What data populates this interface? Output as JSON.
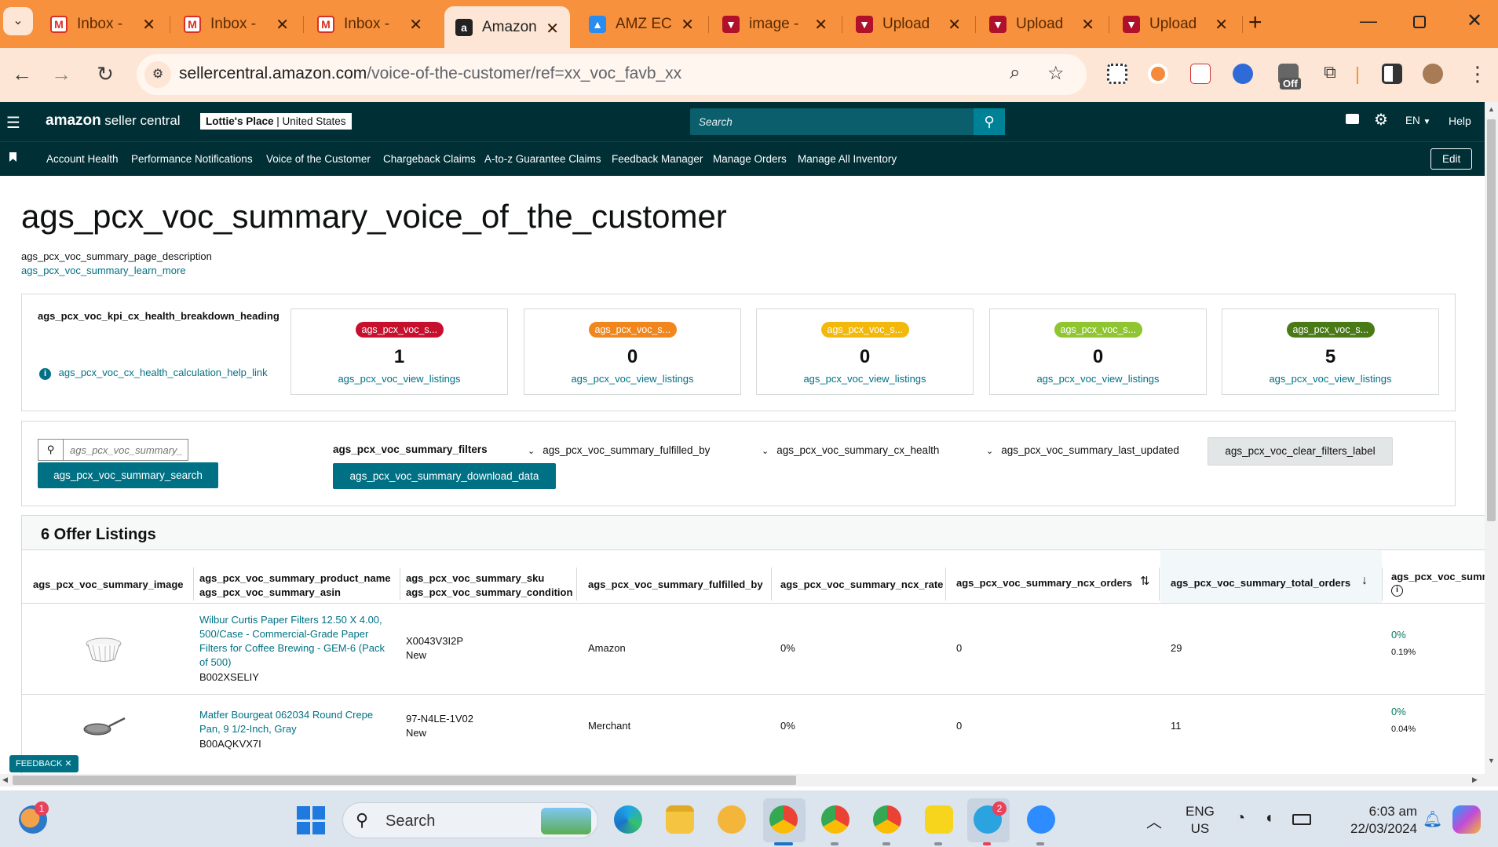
{
  "browser": {
    "tabs": [
      {
        "label": "Inbox -",
        "icon": "gmail-icon"
      },
      {
        "label": "Inbox -",
        "icon": "gmail-icon"
      },
      {
        "label": "Inbox -",
        "icon": "gmail-icon"
      },
      {
        "label": "Amazon",
        "icon": "amazon-icon",
        "active": true
      },
      {
        "label": "AMZ EC",
        "icon": "app-icon"
      },
      {
        "label": "image -",
        "icon": "upload-app-icon"
      },
      {
        "label": "Upload",
        "icon": "upload-app-icon"
      },
      {
        "label": "Upload",
        "icon": "upload-app-icon"
      },
      {
        "label": "Upload",
        "icon": "upload-app-icon"
      }
    ],
    "new_tab": "+",
    "url_host": "sellercentral.amazon.com",
    "url_path": "/voice-of-the-customer/ref=xx_voc_favb_xx",
    "ext_badge": "Off"
  },
  "header": {
    "logo_amazon": "amazon",
    "logo_seller": "seller central",
    "store": "Lottie's Place",
    "marketplace": "United States",
    "search_placeholder": "Search",
    "language": "EN",
    "help": "Help"
  },
  "nav": {
    "items": [
      "Account Health",
      "Performance Notifications",
      "Voice of the Customer",
      "Chargeback Claims",
      "A-to-z Guarantee Claims",
      "Feedback Manager",
      "Manage Orders",
      "Manage All Inventory"
    ],
    "edit": "Edit"
  },
  "page": {
    "title": "ags_pcx_voc_summary_voice_of_the_customer",
    "description": "ags_pcx_voc_summary_page_description",
    "learn_more": "ags_pcx_voc_summary_learn_more"
  },
  "kpi": {
    "heading": "ags_pcx_voc_kpi_cx_health_breakdown_heading",
    "help_link": "ags_pcx_voc_cx_health_calculation_help_link",
    "cards": [
      {
        "pill": "ags_pcx_voc_s...",
        "color": "#c7102e",
        "count": "1",
        "link": "ags_pcx_voc_view_listings"
      },
      {
        "pill": "ags_pcx_voc_s...",
        "color": "#f0861d",
        "count": "0",
        "link": "ags_pcx_voc_view_listings"
      },
      {
        "pill": "ags_pcx_voc_s...",
        "color": "#f2b80c",
        "count": "0",
        "link": "ags_pcx_voc_view_listings"
      },
      {
        "pill": "ags_pcx_voc_s...",
        "color": "#8fc530",
        "count": "0",
        "link": "ags_pcx_voc_view_listings"
      },
      {
        "pill": "ags_pcx_voc_s...",
        "color": "#4a7a17",
        "count": "5",
        "link": "ags_pcx_voc_view_listings"
      }
    ]
  },
  "filters": {
    "search_placeholder": "ags_pcx_voc_summary_",
    "search_button": "ags_pcx_voc_summary_search",
    "filters_label": "ags_pcx_voc_summary_filters",
    "download": "ags_pcx_voc_summary_download_data",
    "fulfilled_by": "ags_pcx_voc_summary_fulfilled_by",
    "cx_health": "ags_pcx_voc_summary_cx_health",
    "last_updated": "ags_pcx_voc_summary_last_updated",
    "clear": "ags_pcx_voc_clear_filters_label"
  },
  "table": {
    "heading": "6 Offer Listings",
    "columns": {
      "image": "ags_pcx_voc_summary_image",
      "product_name": "ags_pcx_voc_summary_product_name",
      "asin": "ags_pcx_voc_summary_asin",
      "sku": "ags_pcx_voc_summary_sku",
      "condition": "ags_pcx_voc_summary_condition",
      "fulfilled_by": "ags_pcx_voc_summary_fulfilled_by",
      "ncx_rate": "ags_pcx_voc_summary_ncx_rate",
      "ncx_orders": "ags_pcx_voc_summary_ncx_orders",
      "total_orders": "ags_pcx_voc_summary_total_orders",
      "last": "ags_pcx_voc_summ"
    },
    "rows": [
      {
        "name": "Wilbur Curtis Paper Filters 12.50 X 4.00, 500/Case - Commercial-Grade Paper Filters for Coffee Brewing - GEM-6 (Pack of 500)",
        "asin": "B002XSELIY",
        "sku": "X0043V3I2P",
        "condition": "New",
        "fulfilled_by": "Amazon",
        "ncx_rate": "0%",
        "ncx_orders": "0",
        "total_orders": "29",
        "last_top": "0%",
        "last_bottom": "0.19%"
      },
      {
        "name": "Matfer Bourgeat 062034 Round Crepe Pan, 9 1/2-Inch, Gray",
        "asin": "B00AQKVX7I",
        "sku": "97-N4LE-1V02",
        "condition": "New",
        "fulfilled_by": "Merchant",
        "ncx_rate": "0%",
        "ncx_orders": "0",
        "total_orders": "11",
        "last_top": "0%",
        "last_bottom": "0.04%"
      }
    ]
  },
  "feedback": "FEEDBACK",
  "taskbar": {
    "search": "Search",
    "lang_top": "ENG",
    "lang_bottom": "US",
    "time": "6:03 am",
    "date": "22/03/2024",
    "badge_weather": "1",
    "badge_telegram": "2"
  }
}
